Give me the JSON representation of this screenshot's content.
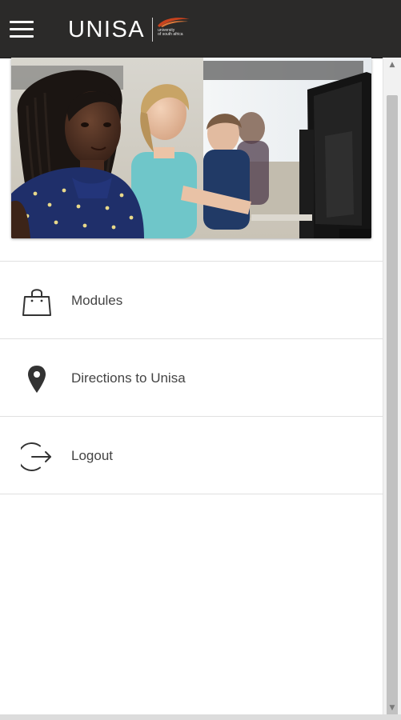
{
  "header": {
    "logo_text": "UNISA",
    "logo_subtext": "university\nof south africa",
    "background_color": "#2b2a29",
    "logo_accent_color": "#c8431e",
    "menu_icon": "hamburger-icon"
  },
  "hero": {
    "image_kind": "photo"
  },
  "menu": {
    "items": [
      {
        "label": "Modules",
        "icon": "shopping-bag-icon"
      },
      {
        "label": "Directions to Unisa",
        "icon": "map-pin-icon"
      },
      {
        "label": "Logout",
        "icon": "logout-icon"
      }
    ]
  },
  "scrollbar": {
    "up_arrow": "▲",
    "down_arrow": "▼"
  }
}
